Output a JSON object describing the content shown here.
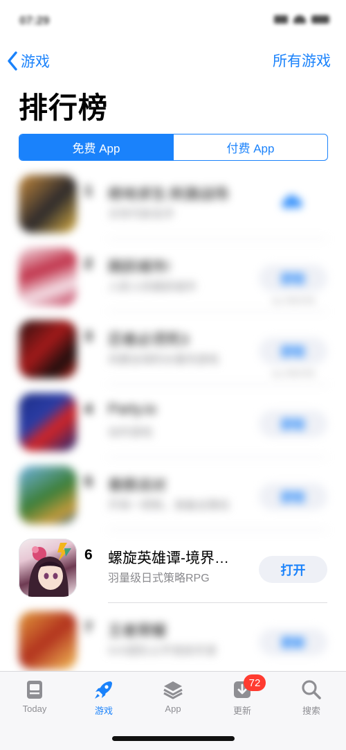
{
  "status_bar": {
    "time": "07:29"
  },
  "nav": {
    "back_label": "游戏",
    "right_label": "所有游戏"
  },
  "page": {
    "title": "排行榜"
  },
  "segments": [
    {
      "label": "免费 App",
      "active": true
    },
    {
      "label": "付费 App",
      "active": false
    }
  ],
  "apps": [
    {
      "rank": "1",
      "name": "绝地求生:刺激战场",
      "subtitle": "次世代射击手",
      "action": "cloud-download-icon",
      "in_app_purchases": "",
      "blurred": true
    },
    {
      "rank": "2",
      "name": "跳跃城市!",
      "subtitle": "人抓人的跳跃城市",
      "action": "获取",
      "in_app_purchases": "App 内购买项目",
      "blurred": true
    },
    {
      "rank": "3",
      "name": "忍者必须死3",
      "subtitle": "风靡全球的水墨风游戏",
      "action": "获取",
      "in_app_purchases": "App 内购买项目",
      "blurred": true
    },
    {
      "rank": "4",
      "name": "Party.io",
      "subtitle": "动作游戏",
      "action": "获取",
      "in_app_purchases": "",
      "blurred": true
    },
    {
      "rank": "5",
      "name": "香肠派对",
      "subtitle": "开局一把枪，装备全靠捡",
      "action": "获取",
      "in_app_purchases": "",
      "blurred": true
    },
    {
      "rank": "6",
      "name": "螺旋英雄谭-境界…",
      "subtitle": "羽量级日式策略RPG",
      "action": "打开",
      "in_app_purchases": "",
      "blurred": false
    },
    {
      "rank": "7",
      "name": "王者荣耀",
      "subtitle": "5V5团队公平竞技手游",
      "action": "更新",
      "in_app_purchases": "",
      "blurred": true
    }
  ],
  "tab_bar": {
    "tabs": [
      {
        "label": "Today",
        "icon": "today-icon",
        "active": false
      },
      {
        "label": "游戏",
        "icon": "rocket-icon",
        "active": true
      },
      {
        "label": "App",
        "icon": "app-stack-icon",
        "active": false
      },
      {
        "label": "更新",
        "icon": "update-download-icon",
        "active": false,
        "badge": "72"
      },
      {
        "label": "搜索",
        "icon": "search-icon",
        "active": false
      }
    ]
  },
  "colors": {
    "accent": "#1a82fb",
    "badge": "#ff3b30",
    "button_bg": "#eef0f6",
    "subtitle": "#8a8a8e"
  }
}
